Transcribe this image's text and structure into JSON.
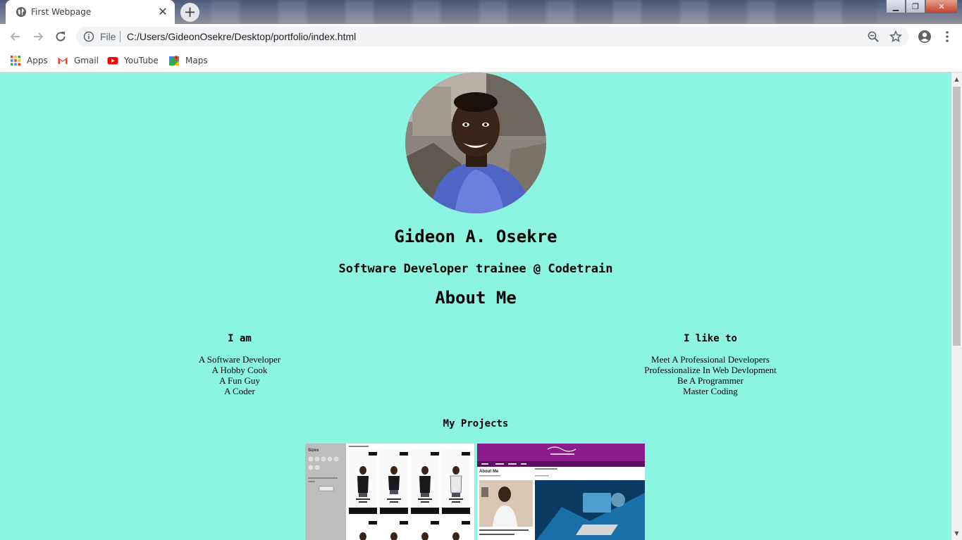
{
  "browser": {
    "tab_title": "First Webpage",
    "scheme_label": "File",
    "url": "C:/Users/GideonOsekre/Desktop/portfolio/index.html",
    "bookmarks": [
      {
        "label": "Apps",
        "icon": "apps-grid-icon"
      },
      {
        "label": "Gmail",
        "icon": "gmail-icon"
      },
      {
        "label": "YouTube",
        "icon": "youtube-icon"
      },
      {
        "label": "Maps",
        "icon": "maps-icon"
      }
    ]
  },
  "profile": {
    "name": "Gideon A. Osekre",
    "role": "Software Developer trainee @ Codetrain"
  },
  "about": {
    "heading": "About Me",
    "i_am": {
      "heading": "I am",
      "items": [
        "A Software Developer",
        "A Hobby Cook",
        "A Fun Guy",
        "A Coder"
      ]
    },
    "i_like": {
      "heading": "I like to",
      "items": [
        "Meet A Professional Developers",
        "Professionalize In Web Devlopment",
        "Be A Programmer",
        "Master Coding"
      ]
    }
  },
  "projects": {
    "heading": "My Projects",
    "thumbs": [
      {
        "caption": "Sizes",
        "button_label": "Add To Cart",
        "product_name": "Cat Tee Black T-Shirt",
        "price": "$ 10.90",
        "badge": "Free shipping"
      },
      {
        "nav_heading": "About Me",
        "article_heading": "TITTLE HEADING",
        "blurb": "We are active and always easy to reach out for"
      }
    ]
  },
  "colors": {
    "page_background": "#8cf5e1",
    "project_header_purple": "#8b1a8c"
  }
}
